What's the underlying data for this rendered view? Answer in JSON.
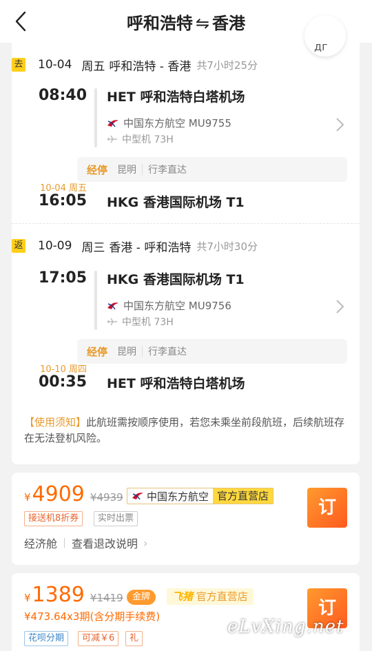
{
  "header": {
    "origin": "呼和浩特",
    "arrow": "⇋",
    "destination": "香港"
  },
  "float_button": {
    "label": "дг"
  },
  "outbound": {
    "tag": "去",
    "date": "10-04",
    "weekday": "周五",
    "route": "呼和浩特 - 香港",
    "duration": "共7小时25分",
    "dep_time": "08:40",
    "dep_airport": "HET 呼和浩特白塔机场",
    "airline": "中国东方航空 MU9755",
    "aircraft": "中型机 73H",
    "stop_label": "经停",
    "stop_city": "昆明",
    "stop_note": "行李直达",
    "arr_date": "10-04 周五",
    "arr_time": "16:05",
    "arr_airport": "HKG 香港国际机场 T1"
  },
  "return": {
    "tag": "返",
    "date": "10-09",
    "weekday": "周三",
    "route": "香港 - 呼和浩特",
    "duration": "共7小时30分",
    "dep_time": "17:05",
    "dep_airport": "HKG 香港国际机场 T1",
    "airline": "中国东方航空 MU9756",
    "aircraft": "中型机 73H",
    "stop_label": "经停",
    "stop_city": "昆明",
    "stop_note": "行李直达",
    "arr_date": "10-10 周四",
    "arr_time": "00:35",
    "arr_airport": "HET 呼和浩特白塔机场"
  },
  "notice": {
    "title": "【使用须知】",
    "text": "此航班需按顺序使用，若您未乘坐前段航班，后续航班存在无法登机风险。"
  },
  "fare1": {
    "currency": "¥",
    "price": "4909",
    "original": "¥4939",
    "brand_name": "中国东方航空",
    "brand_tag": "官方直营店",
    "pill_1": "接送机8折券",
    "pill_2": "实时出票",
    "cabin": "经济舱",
    "policy": "查看退改说明",
    "chevron": "›",
    "book": "订"
  },
  "fare2": {
    "currency": "¥",
    "price": "1389",
    "original": "¥1419",
    "gold": "金牌",
    "shop_logo": "飞猪",
    "shop_tag": "官方直营店",
    "installment": "¥473.64x3期(含分期手续费)",
    "pill_1": "花呗分期",
    "pill_2": "可减￥6",
    "pill_3": "礼",
    "book": "订"
  },
  "watermark": "eLvXing.net",
  "colors": {
    "accent": "#ff6a00",
    "stop": "#e89a2c",
    "tag": "#ffcf1a",
    "book_start": "#ff9a2e",
    "book_end": "#ff5a1f"
  }
}
